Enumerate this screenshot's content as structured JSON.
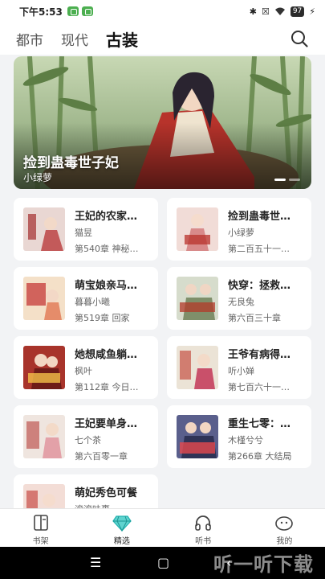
{
  "status_bar": {
    "time": "下午5:53",
    "battery": "97"
  },
  "tabs": [
    {
      "label": "都市"
    },
    {
      "label": "现代"
    },
    {
      "label": "古装"
    }
  ],
  "banner": {
    "title": "捡到蛊毒世子妃",
    "author": "小绿萝"
  },
  "books": [
    {
      "title": "王妃的农家…",
      "author": "猫昱",
      "meta": "第540章 神秘…",
      "cover_color": "#e9d7d3"
    },
    {
      "title": "捡到蛊毒世…",
      "author": "小绿萝",
      "meta": "第二百五十一…",
      "cover_color": "#f1dcd7"
    },
    {
      "title": "萌宝娘亲马…",
      "author": "暮暮小曦",
      "meta": "第519章 回家",
      "cover_color": "#f4e0c8"
    },
    {
      "title": "快穿：拯救…",
      "author": "无良兔",
      "meta": "第六百三十章",
      "cover_color": "#d6dccc"
    },
    {
      "title": "她想咸鱼躺…",
      "author": "枫叶",
      "meta": "第112章 今日…",
      "cover_color": "#a8342b"
    },
    {
      "title": "王爷有病得…",
      "author": "听小婵",
      "meta": "第七百六十一…",
      "cover_color": "#ebe3d6"
    },
    {
      "title": "王妃要单身…",
      "author": "七个茶",
      "meta": "第六百零一章",
      "cover_color": "#efe5df"
    },
    {
      "title": "重生七零：…",
      "author": "木槿兮兮",
      "meta": "第266章 大结局",
      "cover_color": "#5a5f8c"
    },
    {
      "title": "萌妃秀色可餐",
      "author": "滚滚味裹",
      "meta": "",
      "cover_color": "#f3ddd6"
    }
  ],
  "bottom_nav": [
    {
      "label": "书架",
      "icon": "bookshelf-icon"
    },
    {
      "label": "精选",
      "icon": "diamond-icon"
    },
    {
      "label": "听书",
      "icon": "headphones-icon"
    },
    {
      "label": "我的",
      "icon": "profile-face-icon"
    }
  ],
  "watermark": "听一听下载",
  "colors": {
    "accent": "#22b3b0",
    "background": "#f2f3f5"
  }
}
